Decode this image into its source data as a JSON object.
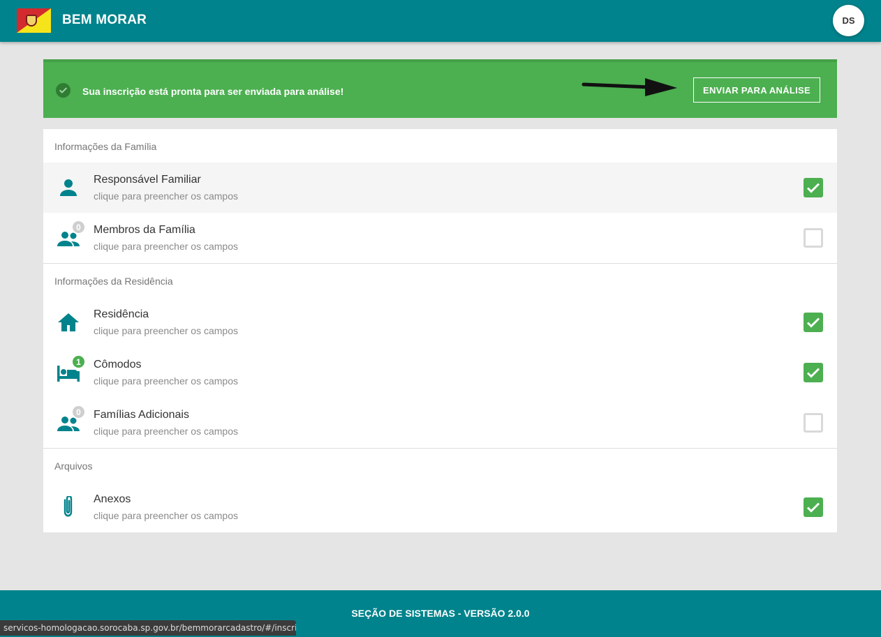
{
  "header": {
    "title": "BEM MORAR",
    "avatar_initials": "DS",
    "brand_color": "#00838c"
  },
  "banner": {
    "message": "Sua inscrição está pronta para ser enviada para análise!",
    "button_label": "ENVIAR PARA ANÁLISE",
    "color": "#4caf50"
  },
  "sections": [
    {
      "title": "Informações da Família",
      "items": [
        {
          "title": "Responsável Familiar",
          "subtitle": "clique para preencher os campos",
          "icon": "person-icon",
          "checked": true
        },
        {
          "title": "Membros da Família",
          "subtitle": "clique para preencher os campos",
          "icon": "people-icon",
          "badge": "0",
          "checked": false
        }
      ]
    },
    {
      "title": "Informações da Residência",
      "items": [
        {
          "title": "Residência",
          "subtitle": "clique para preencher os campos",
          "icon": "home-icon",
          "checked": true
        },
        {
          "title": "Cômodos",
          "subtitle": "clique para preencher os campos",
          "icon": "bed-icon",
          "badge": "1",
          "checked": true
        },
        {
          "title": "Famílias Adicionais",
          "subtitle": "clique para preencher os campos",
          "icon": "people-icon",
          "badge": "0",
          "checked": false
        }
      ]
    },
    {
      "title": "Arquivos",
      "items": [
        {
          "title": "Anexos",
          "subtitle": "clique para preencher os campos",
          "icon": "paperclip-icon",
          "checked": true
        }
      ]
    }
  ],
  "footer": {
    "text": "SEÇÃO DE SISTEMAS - VERSÃO 2.0.0"
  },
  "statusbar": {
    "url": "servicos-homologacao.sorocaba.sp.gov.br/bemmorarcadastro/#/inscricao/fa..."
  }
}
